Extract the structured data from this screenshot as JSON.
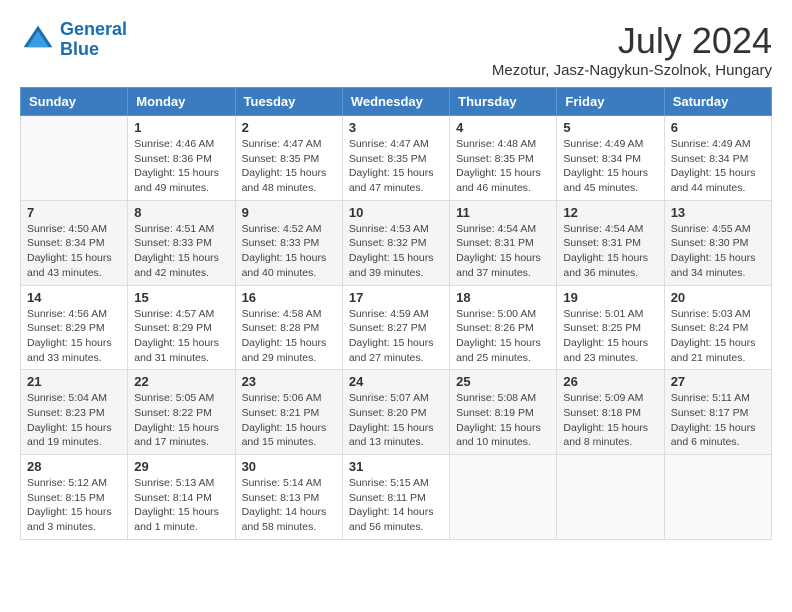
{
  "logo": {
    "line1": "General",
    "line2": "Blue"
  },
  "title": "July 2024",
  "location": "Mezotur, Jasz-Nagykun-Szolnok, Hungary",
  "headers": [
    "Sunday",
    "Monday",
    "Tuesday",
    "Wednesday",
    "Thursday",
    "Friday",
    "Saturday"
  ],
  "weeks": [
    [
      {
        "day": "",
        "info": ""
      },
      {
        "day": "1",
        "info": "Sunrise: 4:46 AM\nSunset: 8:36 PM\nDaylight: 15 hours\nand 49 minutes."
      },
      {
        "day": "2",
        "info": "Sunrise: 4:47 AM\nSunset: 8:35 PM\nDaylight: 15 hours\nand 48 minutes."
      },
      {
        "day": "3",
        "info": "Sunrise: 4:47 AM\nSunset: 8:35 PM\nDaylight: 15 hours\nand 47 minutes."
      },
      {
        "day": "4",
        "info": "Sunrise: 4:48 AM\nSunset: 8:35 PM\nDaylight: 15 hours\nand 46 minutes."
      },
      {
        "day": "5",
        "info": "Sunrise: 4:49 AM\nSunset: 8:34 PM\nDaylight: 15 hours\nand 45 minutes."
      },
      {
        "day": "6",
        "info": "Sunrise: 4:49 AM\nSunset: 8:34 PM\nDaylight: 15 hours\nand 44 minutes."
      }
    ],
    [
      {
        "day": "7",
        "info": "Sunrise: 4:50 AM\nSunset: 8:34 PM\nDaylight: 15 hours\nand 43 minutes."
      },
      {
        "day": "8",
        "info": "Sunrise: 4:51 AM\nSunset: 8:33 PM\nDaylight: 15 hours\nand 42 minutes."
      },
      {
        "day": "9",
        "info": "Sunrise: 4:52 AM\nSunset: 8:33 PM\nDaylight: 15 hours\nand 40 minutes."
      },
      {
        "day": "10",
        "info": "Sunrise: 4:53 AM\nSunset: 8:32 PM\nDaylight: 15 hours\nand 39 minutes."
      },
      {
        "day": "11",
        "info": "Sunrise: 4:54 AM\nSunset: 8:31 PM\nDaylight: 15 hours\nand 37 minutes."
      },
      {
        "day": "12",
        "info": "Sunrise: 4:54 AM\nSunset: 8:31 PM\nDaylight: 15 hours\nand 36 minutes."
      },
      {
        "day": "13",
        "info": "Sunrise: 4:55 AM\nSunset: 8:30 PM\nDaylight: 15 hours\nand 34 minutes."
      }
    ],
    [
      {
        "day": "14",
        "info": "Sunrise: 4:56 AM\nSunset: 8:29 PM\nDaylight: 15 hours\nand 33 minutes."
      },
      {
        "day": "15",
        "info": "Sunrise: 4:57 AM\nSunset: 8:29 PM\nDaylight: 15 hours\nand 31 minutes."
      },
      {
        "day": "16",
        "info": "Sunrise: 4:58 AM\nSunset: 8:28 PM\nDaylight: 15 hours\nand 29 minutes."
      },
      {
        "day": "17",
        "info": "Sunrise: 4:59 AM\nSunset: 8:27 PM\nDaylight: 15 hours\nand 27 minutes."
      },
      {
        "day": "18",
        "info": "Sunrise: 5:00 AM\nSunset: 8:26 PM\nDaylight: 15 hours\nand 25 minutes."
      },
      {
        "day": "19",
        "info": "Sunrise: 5:01 AM\nSunset: 8:25 PM\nDaylight: 15 hours\nand 23 minutes."
      },
      {
        "day": "20",
        "info": "Sunrise: 5:03 AM\nSunset: 8:24 PM\nDaylight: 15 hours\nand 21 minutes."
      }
    ],
    [
      {
        "day": "21",
        "info": "Sunrise: 5:04 AM\nSunset: 8:23 PM\nDaylight: 15 hours\nand 19 minutes."
      },
      {
        "day": "22",
        "info": "Sunrise: 5:05 AM\nSunset: 8:22 PM\nDaylight: 15 hours\nand 17 minutes."
      },
      {
        "day": "23",
        "info": "Sunrise: 5:06 AM\nSunset: 8:21 PM\nDaylight: 15 hours\nand 15 minutes."
      },
      {
        "day": "24",
        "info": "Sunrise: 5:07 AM\nSunset: 8:20 PM\nDaylight: 15 hours\nand 13 minutes."
      },
      {
        "day": "25",
        "info": "Sunrise: 5:08 AM\nSunset: 8:19 PM\nDaylight: 15 hours\nand 10 minutes."
      },
      {
        "day": "26",
        "info": "Sunrise: 5:09 AM\nSunset: 8:18 PM\nDaylight: 15 hours\nand 8 minutes."
      },
      {
        "day": "27",
        "info": "Sunrise: 5:11 AM\nSunset: 8:17 PM\nDaylight: 15 hours\nand 6 minutes."
      }
    ],
    [
      {
        "day": "28",
        "info": "Sunrise: 5:12 AM\nSunset: 8:15 PM\nDaylight: 15 hours\nand 3 minutes."
      },
      {
        "day": "29",
        "info": "Sunrise: 5:13 AM\nSunset: 8:14 PM\nDaylight: 15 hours\nand 1 minute."
      },
      {
        "day": "30",
        "info": "Sunrise: 5:14 AM\nSunset: 8:13 PM\nDaylight: 14 hours\nand 58 minutes."
      },
      {
        "day": "31",
        "info": "Sunrise: 5:15 AM\nSunset: 8:11 PM\nDaylight: 14 hours\nand 56 minutes."
      },
      {
        "day": "",
        "info": ""
      },
      {
        "day": "",
        "info": ""
      },
      {
        "day": "",
        "info": ""
      }
    ]
  ]
}
